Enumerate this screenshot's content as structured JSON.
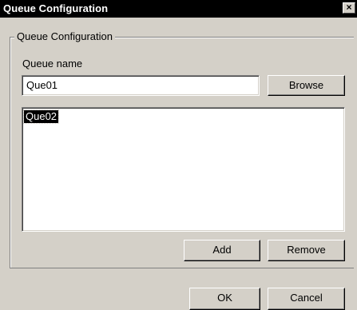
{
  "window": {
    "title": "Queue Configuration",
    "close_glyph": "×"
  },
  "group": {
    "label": "Queue Configuration"
  },
  "queue_name": {
    "label": "Queue name",
    "value": "Que01"
  },
  "buttons": {
    "browse": "Browse",
    "add": "Add",
    "remove": "Remove",
    "ok": "OK",
    "cancel": "Cancel"
  },
  "queue_list": {
    "items": [
      {
        "label": "Que02",
        "selected": true
      }
    ]
  },
  "colors": {
    "face": "#d4d0c8",
    "titlebar": "#000000",
    "selection": "#000000"
  }
}
